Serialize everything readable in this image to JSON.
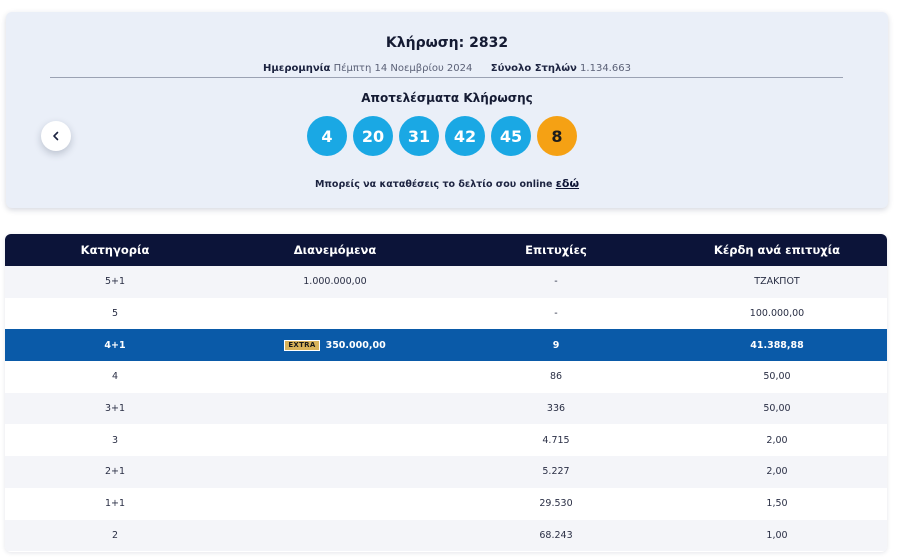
{
  "draw": {
    "title": "Κλήρωση: 2832",
    "date_label": "Ημερομηνία",
    "date_value": "Πέμπτη 14 Νοεμβρίου 2024",
    "columns_label": "Σύνολο Στηλών",
    "columns_value": "1.134.663",
    "results_title": "Αποτελέσματα Κλήρωσης",
    "numbers": [
      "4",
      "20",
      "31",
      "42",
      "45"
    ],
    "joker": "8",
    "online_text": "Μπορείς να καταθέσεις το δελτίο σου online",
    "online_link": "εδώ",
    "prev_icon": "chevron-left-icon"
  },
  "colors": {
    "ball": "#1aa8e4",
    "joker_ball": "#f5a114",
    "header_bg": "#0c1439",
    "highlight_row": "#0a5aa8"
  },
  "table": {
    "headers": [
      "Κατηγορία",
      "Διανεμόμενα",
      "Επιτυχίες",
      "Κέρδη ανά επιτυχία"
    ],
    "rows": [
      {
        "category": "5+1",
        "distributed": "1.000.000,00",
        "badge": "",
        "winners": "-",
        "prize": "ΤΖΑΚΠΟΤ"
      },
      {
        "category": "5",
        "distributed": "",
        "badge": "",
        "winners": "-",
        "prize": "100.000,00"
      },
      {
        "category": "4+1",
        "distributed": "350.000,00",
        "badge": "EXTRA",
        "winners": "9",
        "prize": "41.388,88"
      },
      {
        "category": "4",
        "distributed": "",
        "badge": "",
        "winners": "86",
        "prize": "50,00"
      },
      {
        "category": "3+1",
        "distributed": "",
        "badge": "",
        "winners": "336",
        "prize": "50,00"
      },
      {
        "category": "3",
        "distributed": "",
        "badge": "",
        "winners": "4.715",
        "prize": "2,00"
      },
      {
        "category": "2+1",
        "distributed": "",
        "badge": "",
        "winners": "5.227",
        "prize": "2,00"
      },
      {
        "category": "1+1",
        "distributed": "",
        "badge": "",
        "winners": "29.530",
        "prize": "1,50"
      },
      {
        "category": "2",
        "distributed": "",
        "badge": "",
        "winners": "68.243",
        "prize": "1,00"
      }
    ]
  }
}
